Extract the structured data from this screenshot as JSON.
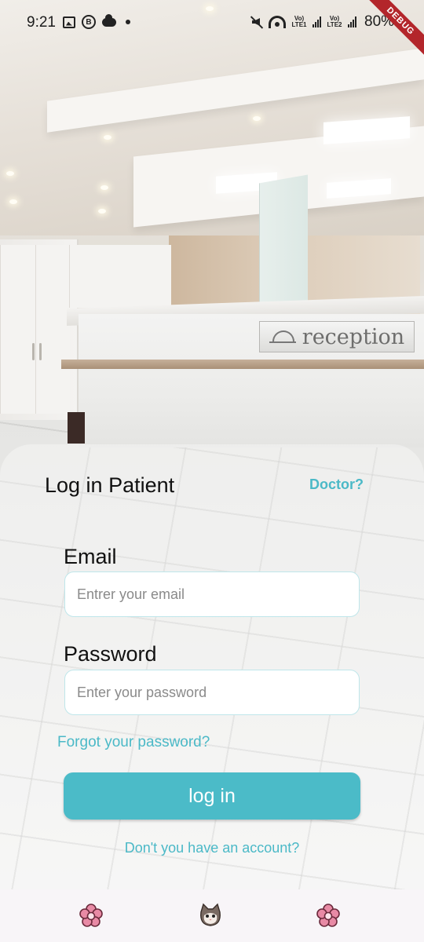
{
  "status_bar": {
    "time": "9:21",
    "battery": "80%",
    "network_1": "Vo) LTE1",
    "network_2": "Vo) LTE2",
    "debug_badge": "DEBUG"
  },
  "background": {
    "sign_text": "reception"
  },
  "login": {
    "title": "Log in Patient",
    "switch_role_link": "Doctor?",
    "email_label": "Email",
    "email_placeholder": "Entrer your email",
    "email_value": "",
    "password_label": "Password",
    "password_placeholder": "Enter your password",
    "password_value": "",
    "forgot_password": "Forgot your password?",
    "login_button": "log in",
    "signup_prompt": "Don't you have an account?"
  },
  "bottom_nav": {
    "items": [
      {
        "icon": "flower-icon"
      },
      {
        "icon": "cat-face-icon"
      },
      {
        "icon": "flower-icon"
      }
    ]
  },
  "colors": {
    "accent": "#4bbbc8",
    "link": "#4bb9c7",
    "input_border": "#bfe6ea",
    "nav_background": "#f8f5f8",
    "flower_pink": "#e88aa5"
  }
}
